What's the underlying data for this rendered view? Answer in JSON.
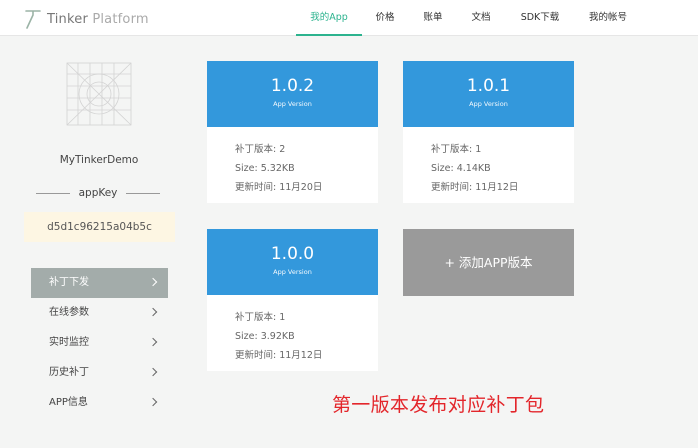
{
  "header": {
    "logo_brand": "Tinker",
    "logo_suffix": " Platform",
    "nav": [
      {
        "label": "我的App",
        "active": true
      },
      {
        "label": "价格"
      },
      {
        "label": "账单"
      },
      {
        "label": "文档"
      },
      {
        "label": "SDK下载"
      },
      {
        "label": "我的帐号"
      }
    ]
  },
  "sidebar": {
    "app_name": "MyTinkerDemo",
    "appkey_label": "appKey",
    "appkey_value": "d5d1c96215a04b5c",
    "menu": [
      {
        "label": "补丁下发",
        "active": true
      },
      {
        "label": "在线参数"
      },
      {
        "label": "实时监控"
      },
      {
        "label": "历史补丁"
      },
      {
        "label": "APP信息"
      }
    ]
  },
  "cards": [
    {
      "version": "1.0.2",
      "subtitle": "App Version",
      "patch": "补丁版本: 2",
      "size": "Size: 5.32KB",
      "updated": "更新时间: 11月20日"
    },
    {
      "version": "1.0.1",
      "subtitle": "App Version",
      "patch": "补丁版本: 1",
      "size": "Size: 4.14KB",
      "updated": "更新时间: 11月12日"
    },
    {
      "version": "1.0.0",
      "subtitle": "App Version",
      "patch": "补丁版本: 1",
      "size": "Size: 3.92KB",
      "updated": "更新时间: 11月12日"
    }
  ],
  "add_version_label": "+ 添加APP版本",
  "annotation": "第一版本发布对应补丁包",
  "colors": {
    "accent": "#2cb38e",
    "card_header": "#3398dc",
    "add_card": "#9a9a9a",
    "menu_active": "#a3acaa",
    "annotation": "#e3262b",
    "appkey_bg": "#fdf6e3"
  }
}
